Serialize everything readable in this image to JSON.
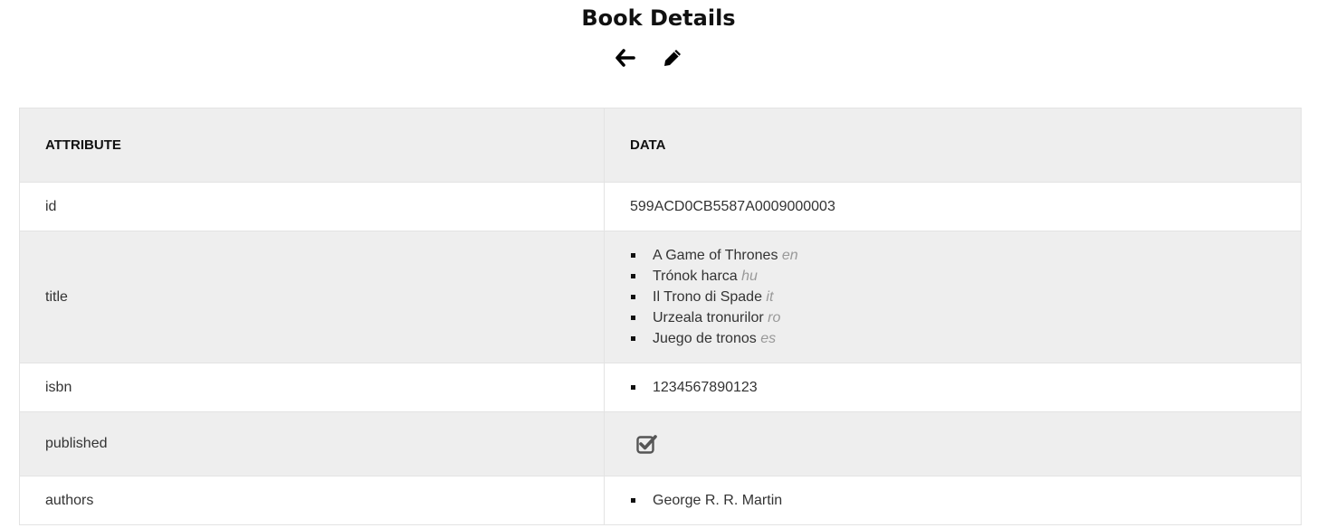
{
  "page": {
    "title": "Book Details"
  },
  "toolbar": {
    "back_icon": "arrow-left-icon",
    "edit_icon": "pencil-icon"
  },
  "table": {
    "headers": {
      "attribute": "ATTRIBUTE",
      "data": "DATA"
    },
    "rows": {
      "id": {
        "label": "id",
        "value": "599ACD0CB5587A0009000003"
      },
      "title": {
        "label": "title",
        "items": [
          {
            "text": "A Game of Thrones",
            "lang": "en"
          },
          {
            "text": "Trónok harca",
            "lang": "hu"
          },
          {
            "text": "Il Trono di Spade",
            "lang": "it"
          },
          {
            "text": "Urzeala tronurilor",
            "lang": "ro"
          },
          {
            "text": "Juego de tronos",
            "lang": "es"
          }
        ]
      },
      "isbn": {
        "label": "isbn",
        "items": [
          "1234567890123"
        ]
      },
      "published": {
        "label": "published",
        "checked": true,
        "icon": "checked-checkbox-icon"
      },
      "authors": {
        "label": "authors",
        "items": [
          "George R. R. Martin"
        ]
      }
    }
  },
  "colors": {
    "row_alt": "#eeeeee",
    "text": "#333333",
    "lang_tag": "#999999"
  }
}
